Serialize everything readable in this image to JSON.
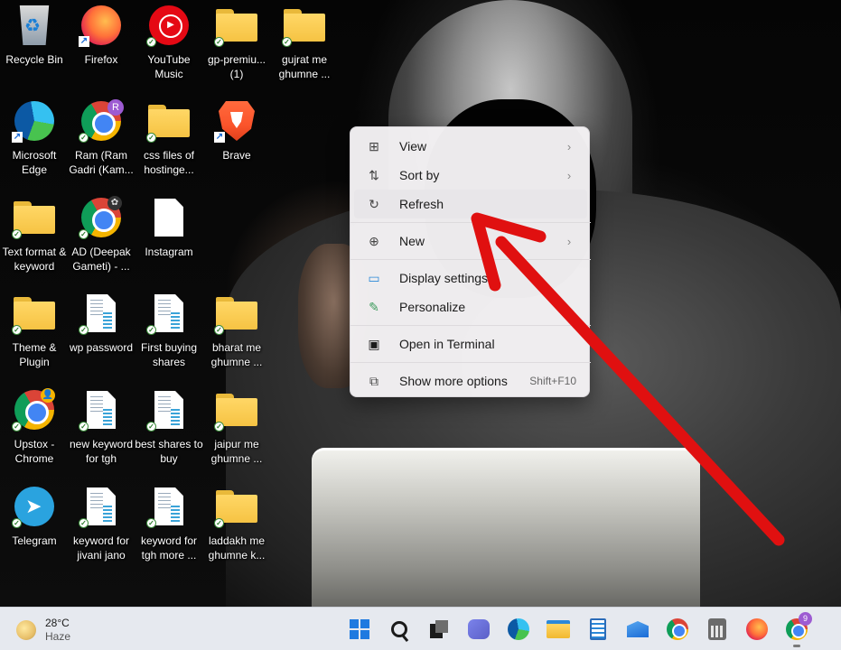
{
  "desktop": {
    "icons": [
      {
        "label": "Recycle Bin",
        "icon": "recycle-bin-icon"
      },
      {
        "label": "Firefox",
        "icon": "firefox-icon"
      },
      {
        "label": "YouTube Music",
        "icon": "youtube-music-icon"
      },
      {
        "label": "gp-premiu... (1)",
        "icon": "folder-icon"
      },
      {
        "label": "gujrat me ghumne ...",
        "icon": "folder-icon"
      },
      {
        "label": "Microsoft Edge",
        "icon": "edge-icon"
      },
      {
        "label": "Ram (Ram Gadri (Kam...",
        "icon": "chrome-icon",
        "badge": "R"
      },
      {
        "label": "css files of hostinge...",
        "icon": "folder-icon"
      },
      {
        "label": "Brave",
        "icon": "brave-icon"
      },
      {
        "label": "Text format & keyword",
        "icon": "folder-icon"
      },
      {
        "label": "AD (Deepak Gameti) - ...",
        "icon": "chrome-icon"
      },
      {
        "label": "Instagram",
        "icon": "blank-file-icon"
      },
      {
        "label": "Theme & Plugin",
        "icon": "folder-icon"
      },
      {
        "label": "wp password",
        "icon": "document-icon"
      },
      {
        "label": "First buying shares",
        "icon": "document-icon"
      },
      {
        "label": "bharat me ghumne ...",
        "icon": "folder-icon"
      },
      {
        "label": "Upstox - Chrome",
        "icon": "chrome-icon"
      },
      {
        "label": "new keyword for tgh",
        "icon": "document-icon"
      },
      {
        "label": "best shares to buy",
        "icon": "document-icon"
      },
      {
        "label": "jaipur me ghumne ...",
        "icon": "folder-icon"
      },
      {
        "label": "Telegram",
        "icon": "telegram-icon"
      },
      {
        "label": "keyword for jivani jano",
        "icon": "document-icon"
      },
      {
        "label": "keyword for tgh more ...",
        "icon": "document-icon"
      },
      {
        "label": "laddakh me ghumne k...",
        "icon": "folder-icon"
      }
    ]
  },
  "context_menu": {
    "items": [
      {
        "label": "View",
        "icon": "grid-view-icon",
        "has_submenu": true
      },
      {
        "label": "Sort by",
        "icon": "sort-icon",
        "has_submenu": true
      },
      {
        "label": "Refresh",
        "icon": "refresh-icon",
        "hovered": true
      },
      {
        "label": "New",
        "icon": "new-plus-icon",
        "has_submenu": true
      },
      {
        "label": "Display settings",
        "icon": "display-settings-icon"
      },
      {
        "label": "Personalize",
        "icon": "personalize-pen-icon"
      },
      {
        "label": "Open in Terminal",
        "icon": "terminal-icon"
      },
      {
        "label": "Show more options",
        "icon": "show-more-options-icon",
        "shortcut": "Shift+F10"
      }
    ]
  },
  "annotation": {
    "color": "#e01010",
    "icon": "red-arrow-pointer"
  },
  "taskbar": {
    "weather": {
      "temp": "28°C",
      "condition": "Haze"
    },
    "apps": [
      "start",
      "search",
      "task-view",
      "teams",
      "edge",
      "file-explorer",
      "notepad",
      "mail",
      "chrome",
      "calculator",
      "firefox",
      "chrome-profile"
    ],
    "chrome_profile_badge": "9"
  },
  "colors": {
    "accent": "#1f7ae0",
    "menu_bg": "#f6f4f6",
    "taskbar_bg": "#e6e9ef",
    "folder": "#f6c343",
    "arrow": "#e01010"
  }
}
